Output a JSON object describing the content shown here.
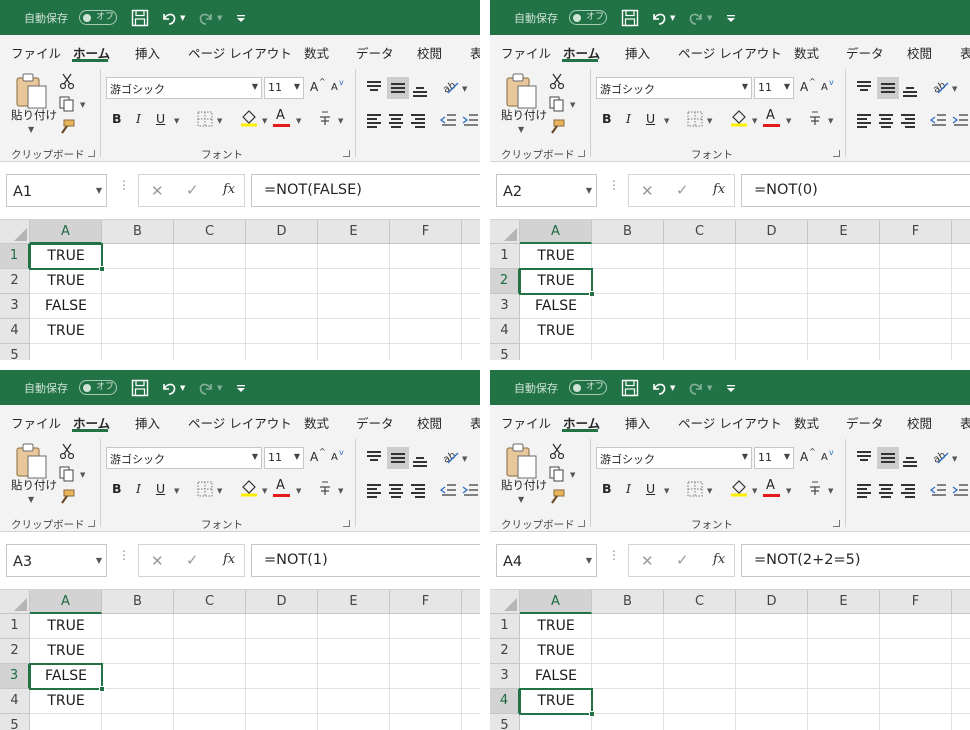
{
  "app": {
    "autosave_label": "自動保存",
    "autosave_state": "オフ",
    "tabs": [
      "ファイル",
      "ホーム",
      "挿入",
      "ページ レイアウト",
      "数式",
      "データ",
      "校閲",
      "表"
    ],
    "active_tab": "ホーム",
    "clipboard": {
      "paste_label": "貼り付け",
      "group_label": "クリップボード"
    },
    "font": {
      "name": "游ゴシック",
      "size": "11",
      "group_label": "フォント",
      "bold": "B",
      "italic": "I",
      "underline": "U",
      "grow": "A",
      "shrink": "A",
      "font_color": "A"
    },
    "columns": [
      "A",
      "B",
      "C",
      "D",
      "E",
      "F"
    ],
    "rows": [
      "1",
      "2",
      "3",
      "4",
      "5"
    ],
    "colors": {
      "excel_green": "#217346",
      "font_color_bar": "#e51b1b",
      "highlight_bar": "#ffef00"
    }
  },
  "panels": [
    {
      "name_box": "A1",
      "formula": "=NOT(FALSE)",
      "selected_row": 1,
      "values": [
        "TRUE",
        "TRUE",
        "FALSE",
        "TRUE"
      ]
    },
    {
      "name_box": "A2",
      "formula": "=NOT(0)",
      "selected_row": 2,
      "values": [
        "TRUE",
        "TRUE",
        "FALSE",
        "TRUE"
      ]
    },
    {
      "name_box": "A3",
      "formula": "=NOT(1)",
      "selected_row": 3,
      "values": [
        "TRUE",
        "TRUE",
        "FALSE",
        "TRUE"
      ]
    },
    {
      "name_box": "A4",
      "formula": "=NOT(2+2=5)",
      "selected_row": 4,
      "values": [
        "TRUE",
        "TRUE",
        "FALSE",
        "TRUE"
      ]
    }
  ]
}
